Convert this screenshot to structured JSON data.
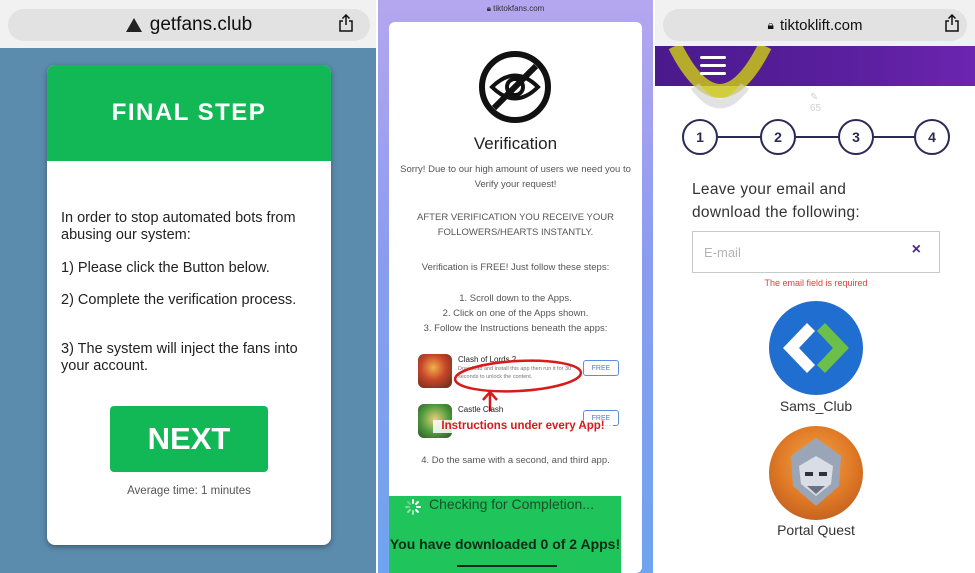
{
  "panel1": {
    "url": "getfans.club",
    "card_title": "FINAL STEP",
    "intro": "In order to stop automated bots from abusing our system:",
    "steps": [
      "1) Please click the Button below.",
      "2) Complete the verification process.",
      "3) The system will inject the fans into your account."
    ],
    "next_label": "NEXT",
    "avg_time": "Average time: 1 minutes",
    "colors": {
      "accent": "#12b856",
      "background": "#5b8bad"
    }
  },
  "panel2": {
    "url": "tiktokfans.com",
    "title": "Verification",
    "sorry": "Sorry! Due to our high amount of users we need you to Verify your request!",
    "after": "AFTER VERIFICATION YOU RECEIVE YOUR FOLLOWERS/HEARTS INSTANTLY.",
    "free_text": "Verification is FREE! Just follow these steps:",
    "steps": [
      "1. Scroll down to the Apps.",
      "2. Click on one of the Apps shown.",
      "3. Follow the Instructions beneath the apps:"
    ],
    "apps": [
      {
        "name": "Clash of Lords 2",
        "description": "Download and install this app then run it for 30 seconds to unlock the content.",
        "button": "FREE"
      },
      {
        "name": "Castle Clash",
        "description": "",
        "button": "FREE"
      }
    ],
    "annotation": "Instructions under every App!",
    "step4": "4. Do the same with a second, and third app.",
    "checking": "Checking for Completion...",
    "downloaded": "You have downloaded 0 of 2 Apps!",
    "icons": [
      "eye-slash-icon",
      "spinner-icon"
    ]
  },
  "panel3": {
    "url": "tiktoklift.com",
    "steps": [
      "1",
      "2",
      "3",
      "4"
    ],
    "heading_line1": "Leave your email and",
    "heading_line2": "download the following:",
    "email_placeholder": "E-mail",
    "clear_symbol": "×",
    "error": "The email field is required",
    "apps": [
      {
        "name": "Sams_Club"
      },
      {
        "name": "Portal Quest"
      }
    ],
    "colors": {
      "header": "#4a1a8c",
      "error": "#e04040"
    }
  }
}
